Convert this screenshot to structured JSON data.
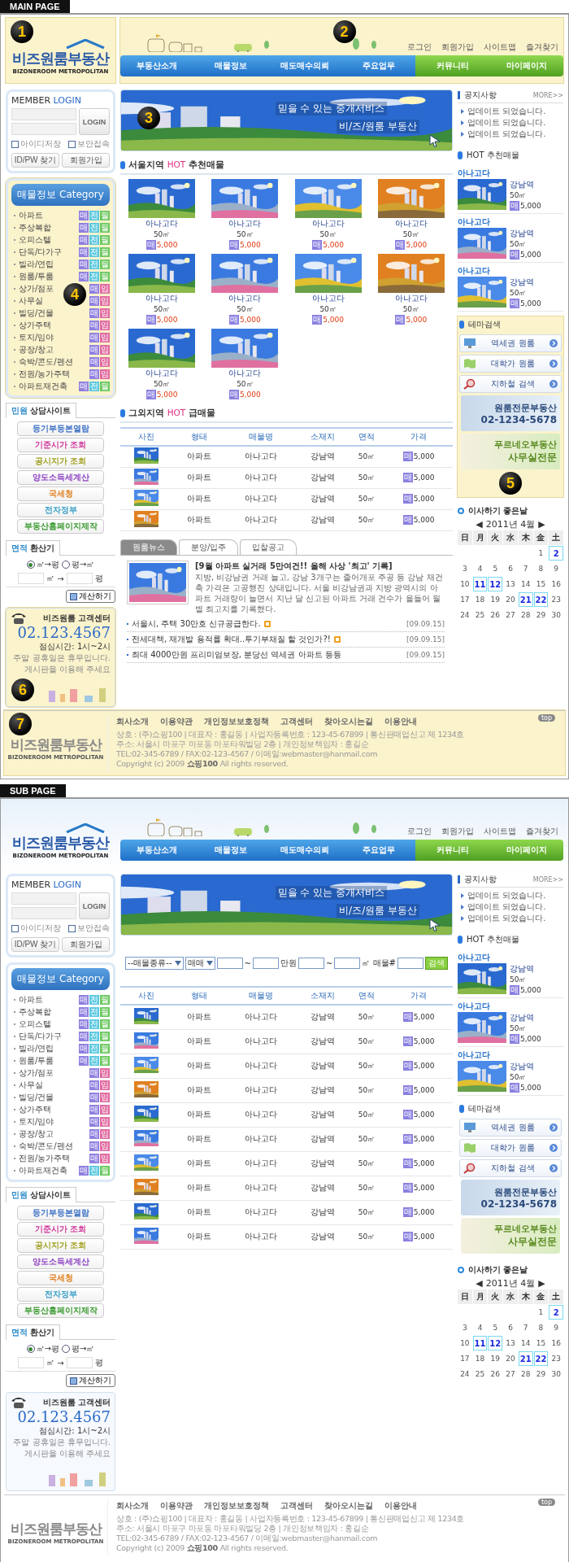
{
  "pages": [
    {
      "label": "MAIN PAGE",
      "kind": "main",
      "header": {
        "logo": {
          "title": "비즈원룸부동산",
          "subtitle": "BIZONEROOM METROPOLITAN",
          "marker": "1"
        },
        "top_links": [
          "로그인",
          "회원가입",
          "사이트맵",
          "즐겨찾기"
        ],
        "nav": [
          {
            "label": "부동산소개",
            "kind": "main"
          },
          {
            "label": "매물정보",
            "kind": "main"
          },
          {
            "label": "매도매수의뢰",
            "kind": "main"
          },
          {
            "label": "주요업무",
            "kind": "main"
          },
          {
            "label": "커뮤니티",
            "kind": "member"
          },
          {
            "label": "마이페이지",
            "kind": "member"
          }
        ],
        "marker": "2"
      },
      "login": {
        "title": "MEMBER",
        "title_accent": "LOGIN",
        "button": "LOGIN",
        "options": [
          {
            "label": "아이디저장",
            "checked": false
          },
          {
            "label": "보안접속",
            "checked": false
          }
        ],
        "buttons": [
          "ID/PW 찾기",
          "회원가입"
        ]
      },
      "category": {
        "title": "매물정보",
        "title_en": "Category",
        "marker": "4",
        "items": [
          {
            "label": "아파트",
            "badges": [
              {
                "t": "매",
                "color": "#8f7fe0"
              },
              {
                "t": "전",
                "color": "#5cc8e0"
              },
              {
                "t": "월",
                "color": "#6cc860"
              }
            ]
          },
          {
            "label": "주상복합",
            "badges": [
              {
                "t": "매",
                "color": "#8f7fe0"
              },
              {
                "t": "전",
                "color": "#5cc8e0"
              },
              {
                "t": "월",
                "color": "#6cc860"
              }
            ]
          },
          {
            "label": "오피스텔",
            "badges": [
              {
                "t": "매",
                "color": "#8f7fe0"
              },
              {
                "t": "전",
                "color": "#5cc8e0"
              },
              {
                "t": "월",
                "color": "#6cc860"
              }
            ]
          },
          {
            "label": "단독/다가구",
            "badges": [
              {
                "t": "매",
                "color": "#8f7fe0"
              },
              {
                "t": "전",
                "color": "#5cc8e0"
              },
              {
                "t": "월",
                "color": "#6cc860"
              }
            ]
          },
          {
            "label": "빌라/연립",
            "badges": [
              {
                "t": "매",
                "color": "#8f7fe0"
              },
              {
                "t": "전",
                "color": "#5cc8e0"
              },
              {
                "t": "월",
                "color": "#6cc860"
              }
            ]
          },
          {
            "label": "원룸/투룸",
            "badges": [
              {
                "t": "매",
                "color": "#8f7fe0"
              },
              {
                "t": "전",
                "color": "#5cc8e0"
              },
              {
                "t": "월",
                "color": "#6cc860"
              }
            ]
          },
          {
            "label": "상가/점포",
            "badges": [
              {
                "t": "매",
                "color": "#8f7fe0"
              },
              {
                "t": "임",
                "color": "#e06aa0"
              }
            ]
          },
          {
            "label": "사무실",
            "badges": [
              {
                "t": "매",
                "color": "#8f7fe0"
              },
              {
                "t": "임",
                "color": "#e06aa0"
              }
            ]
          },
          {
            "label": "빌딩/건물",
            "badges": [
              {
                "t": "매",
                "color": "#8f7fe0"
              },
              {
                "t": "임",
                "color": "#e06aa0"
              }
            ]
          },
          {
            "label": "상가주택",
            "badges": [
              {
                "t": "매",
                "color": "#8f7fe0"
              },
              {
                "t": "임",
                "color": "#e06aa0"
              }
            ]
          },
          {
            "label": "토지/임야",
            "badges": [
              {
                "t": "매",
                "color": "#8f7fe0"
              },
              {
                "t": "임",
                "color": "#e06aa0"
              }
            ]
          },
          {
            "label": "공장/창고",
            "badges": [
              {
                "t": "매",
                "color": "#8f7fe0"
              },
              {
                "t": "임",
                "color": "#e06aa0"
              }
            ]
          },
          {
            "label": "숙박/콘도/펜션",
            "badges": [
              {
                "t": "매",
                "color": "#8f7fe0"
              },
              {
                "t": "임",
                "color": "#e06aa0"
              }
            ]
          },
          {
            "label": "전원/농가주택",
            "badges": [
              {
                "t": "매",
                "color": "#8f7fe0"
              },
              {
                "t": "임",
                "color": "#e06aa0"
              }
            ]
          },
          {
            "label": "아파트재건축",
            "badges": [
              {
                "t": "매",
                "color": "#8f7fe0"
              },
              {
                "t": "전",
                "color": "#5cc8e0"
              },
              {
                "t": "월",
                "color": "#6cc860"
              }
            ]
          }
        ]
      },
      "consult": {
        "tab_accent": "민원",
        "tab": "상담사이트",
        "links": [
          {
            "label": "등기부등본열람",
            "color": "#3a6fc4"
          },
          {
            "label": "기준시가 조회",
            "color": "#d0359a"
          },
          {
            "label": "공시지가 조회",
            "color": "#a0a020"
          },
          {
            "label": "양도소득세계산",
            "color": "#8a3ec0"
          },
          {
            "label": "국세청",
            "color": "#e08020"
          },
          {
            "label": "전자정부",
            "color": "#3aa0c8"
          },
          {
            "label": "부동산홈페이지제작",
            "color": "#3a9a30"
          }
        ]
      },
      "converter": {
        "tab_accent": "면적",
        "tab": "환산기",
        "options": [
          {
            "label": "㎡→평",
            "selected": true
          },
          {
            "label": "평→㎡",
            "selected": false
          }
        ],
        "unit_from": "㎡",
        "arrow": "→",
        "unit_to": "평",
        "button": "계산하기"
      },
      "support": {
        "title": "비즈원룸 고객센터",
        "phone": "02.123.4567",
        "hours": "점심시간: 1시~2시",
        "notes": [
          "주말 공휴일은 휴무입니다.",
          "게시판을 이용해 주세요"
        ],
        "marker": "6"
      },
      "banner": {
        "lines": [
          "믿을 수 있는 중개서비스",
          "비/즈/원룸 부동산"
        ],
        "marker": "3"
      },
      "blocks": [
        {
          "kind": "gallery",
          "title": {
            "pre": "서울지역",
            "accent": "HOT",
            "post": "추천매물"
          },
          "items": [
            {
              "name": "아나고다",
              "area": "50㎡",
              "tag": "매",
              "price": "5,000"
            },
            {
              "name": "아나고다",
              "area": "50㎡",
              "tag": "매",
              "price": "5,000"
            },
            {
              "name": "아나고다",
              "area": "50㎡",
              "tag": "매",
              "price": "5,000"
            },
            {
              "name": "아나고다",
              "area": "50㎡",
              "tag": "매",
              "price": "5,000"
            },
            {
              "name": "아나고다",
              "area": "50㎡",
              "tag": "매",
              "price": "5,000"
            },
            {
              "name": "아나고다",
              "area": "50㎡",
              "tag": "매",
              "price": "5,000"
            },
            {
              "name": "아나고다",
              "area": "50㎡",
              "tag": "매",
              "price": "5,000"
            },
            {
              "name": "아나고다",
              "area": "50㎡",
              "tag": "매",
              "price": "5,000"
            },
            {
              "name": "아나고다",
              "area": "50㎡",
              "tag": "매",
              "price": "5,000"
            },
            {
              "name": "아나고다",
              "area": "50㎡",
              "tag": "매",
              "price": "5,000"
            }
          ]
        },
        {
          "kind": "table",
          "title": {
            "pre": "그외지역",
            "accent": "HOT",
            "post": "급매물"
          },
          "columns": [
            "사진",
            "형태",
            "매물명",
            "소재지",
            "면적",
            "가격"
          ],
          "rows": [
            {
              "type": "아파트",
              "name": "아나고다",
              "location": "강남역",
              "area": "50㎡",
              "tag": "매",
              "price": "5,000"
            },
            {
              "type": "아파트",
              "name": "아나고다",
              "location": "강남역",
              "area": "50㎡",
              "tag": "매",
              "price": "5,000"
            },
            {
              "type": "아파트",
              "name": "아나고다",
              "location": "강남역",
              "area": "50㎡",
              "tag": "매",
              "price": "5,000"
            },
            {
              "type": "아파트",
              "name": "아나고다",
              "location": "강남역",
              "area": "50㎡",
              "tag": "매",
              "price": "5,000"
            }
          ]
        },
        {
          "kind": "news",
          "tabs": [
            {
              "label": "원룸뉴스",
              "selected": true
            },
            {
              "label": "분양/입주",
              "selected": false
            },
            {
              "label": "입찰공고",
              "selected": false
            }
          ],
          "headline": "[9월 아파트 실거래 5만여건!! 올해 사상 '최고' 기록]",
          "body": "지방, 비강남권 거래 늘고, 강남 3개구는 줄어개포 주공 등 강남 재건축 가격은 고공행진 상태입니다. 서울 비강남권과 지방 광역시의 아파트 거래량이 늘면서 지난 달 신고된 아파트 거래 건수가 올들어 월별 최고치를 기록했다.",
          "items": [
            {
              "title": "서울시, 주택 30만호 신규공급한다.",
              "new": true,
              "date": "[09.09.15]"
            },
            {
              "title": "전세대책, 재개발 용적률 확대..투기부채질 할 것인가?!",
              "new": true,
              "date": "[09.09.15]"
            },
            {
              "title": "최대 4000만원 프리미엄보장, 분당선 역세권 아파트 등등",
              "new": false,
              "date": "[09.09.15]"
            }
          ]
        }
      ],
      "notice": {
        "title": "공지사항",
        "more": "MORE>>",
        "items": [
          "업데이트 되었습니다.",
          "업데이트 되었습니다.",
          "업데이트 되었습니다."
        ]
      },
      "hot": {
        "title": "HOT 추천매물",
        "items": [
          {
            "name": "아나고다",
            "location": "강남역",
            "area": "50㎡",
            "tag": "매",
            "price": "5,000"
          },
          {
            "name": "아나고다",
            "location": "강남역",
            "area": "50㎡",
            "tag": "매",
            "price": "5,000"
          },
          {
            "name": "아나고다",
            "location": "강남역",
            "area": "50㎡",
            "tag": "매",
            "price": "5,000"
          }
        ]
      },
      "theme": {
        "title": "테마검색",
        "buttons": [
          "역세권 원룸",
          "대학가 원룸",
          "지하철 검색"
        ],
        "ads": [
          {
            "line1": "원룸전문부동산",
            "line2": "02-1234-5678"
          },
          {
            "line1": "푸르네오부동산",
            "line2": "사무실전문"
          }
        ],
        "marker": "5"
      },
      "calendar": {
        "title": "이사하기 좋은날",
        "prev": "◀",
        "month": "2011년 4월",
        "next": "▶",
        "weekdays": [
          "日",
          "月",
          "火",
          "水",
          "木",
          "金",
          "土"
        ],
        "weeks": [
          [
            {
              "d": "1",
              "good": false
            },
            {
              "d": "2",
              "good": true
            }
          ],
          [
            {
              "d": "3",
              "good": false
            },
            {
              "d": "4",
              "good": false
            },
            {
              "d": "5",
              "good": false
            },
            {
              "d": "6",
              "good": false
            },
            {
              "d": "7",
              "good": false
            },
            {
              "d": "8",
              "good": false
            },
            {
              "d": "9",
              "good": false
            }
          ],
          [
            {
              "d": "10",
              "good": false
            },
            {
              "d": "11",
              "good": true
            },
            {
              "d": "12",
              "good": true
            },
            {
              "d": "13",
              "good": false
            },
            {
              "d": "14",
              "good": false
            },
            {
              "d": "15",
              "good": false
            },
            {
              "d": "16",
              "good": false
            }
          ],
          [
            {
              "d": "17",
              "good": false
            },
            {
              "d": "18",
              "good": false
            },
            {
              "d": "19",
              "good": false
            },
            {
              "d": "20",
              "good": false
            },
            {
              "d": "21",
              "good": true
            },
            {
              "d": "22",
              "good": true
            },
            {
              "d": "23",
              "good": false
            }
          ],
          [
            {
              "d": "24",
              "good": false
            },
            {
              "d": "25",
              "good": false
            },
            {
              "d": "26",
              "good": false
            },
            {
              "d": "27",
              "good": false
            },
            {
              "d": "28",
              "good": false
            },
            {
              "d": "29",
              "good": false
            },
            {
              "d": "30",
              "good": false
            }
          ]
        ]
      },
      "footer": {
        "logo": "비즈원룸부동산",
        "logo_sub": "BIZONEROOM METROPOLITAN",
        "links": [
          "회사소개",
          "이용약관",
          "개인정보보호정책",
          "고객센터",
          "찾아오시는길",
          "이용안내"
        ],
        "lines": [
          "상호 : (주)쇼핑100 | 대표자 : 홍길동 | 사업자등록번호 : 123-45-67899 | 통신판매업신고 제 1234호",
          "주소: 서울시 마포구 마포동 마포타워빌딩 2층 | 개인정보책임자 : 홍길순",
          "TEL:02-345-6789 / FAX:02-123-4567 / 이메일:webmaster@hanmail.com",
          "Copyright (c) 2009 **쇼핑100** All rights reserved."
        ],
        "top": "top",
        "marker": "7"
      }
    },
    {
      "label": "SUB PAGE",
      "kind": "sub",
      "header": {
        "logo": {
          "title": "비즈원룸부동산",
          "subtitle": "BIZONEROOM METROPOLITAN"
        },
        "top_links": [
          "로그인",
          "회원가입",
          "사이트맵",
          "즐겨찾기"
        ],
        "nav": [
          {
            "label": "부동산소개",
            "kind": "main"
          },
          {
            "label": "매물정보",
            "kind": "main"
          },
          {
            "label": "매도매수의뢰",
            "kind": "main"
          },
          {
            "label": "주요업무",
            "kind": "main"
          },
          {
            "label": "커뮤니티",
            "kind": "member"
          },
          {
            "label": "마이페이지",
            "kind": "member"
          }
        ]
      },
      "login": {
        "title": "MEMBER",
        "title_accent": "LOGIN",
        "button": "LOGIN",
        "options": [
          {
            "label": "아이디저장",
            "checked": false
          },
          {
            "label": "보안접속",
            "checked": false
          }
        ],
        "buttons": [
          "ID/PW 찾기",
          "회원가입"
        ]
      },
      "category": {
        "title": "매물정보",
        "title_en": "Category",
        "items": [
          {
            "label": "아파트",
            "badges": [
              {
                "t": "매",
                "color": "#8f7fe0"
              },
              {
                "t": "전",
                "color": "#5cc8e0"
              },
              {
                "t": "월",
                "color": "#6cc860"
              }
            ]
          },
          {
            "label": "주상복합",
            "badges": [
              {
                "t": "매",
                "color": "#8f7fe0"
              },
              {
                "t": "전",
                "color": "#5cc8e0"
              },
              {
                "t": "월",
                "color": "#6cc860"
              }
            ]
          },
          {
            "label": "오피스텔",
            "badges": [
              {
                "t": "매",
                "color": "#8f7fe0"
              },
              {
                "t": "전",
                "color": "#5cc8e0"
              },
              {
                "t": "월",
                "color": "#6cc860"
              }
            ]
          },
          {
            "label": "단독/다가구",
            "badges": [
              {
                "t": "매",
                "color": "#8f7fe0"
              },
              {
                "t": "전",
                "color": "#5cc8e0"
              },
              {
                "t": "월",
                "color": "#6cc860"
              }
            ]
          },
          {
            "label": "빌라/연립",
            "badges": [
              {
                "t": "매",
                "color": "#8f7fe0"
              },
              {
                "t": "전",
                "color": "#5cc8e0"
              },
              {
                "t": "월",
                "color": "#6cc860"
              }
            ]
          },
          {
            "label": "원룸/투룸",
            "badges": [
              {
                "t": "매",
                "color": "#8f7fe0"
              },
              {
                "t": "전",
                "color": "#5cc8e0"
              },
              {
                "t": "월",
                "color": "#6cc860"
              }
            ]
          },
          {
            "label": "상가/점포",
            "badges": [
              {
                "t": "매",
                "color": "#8f7fe0"
              },
              {
                "t": "임",
                "color": "#e06aa0"
              }
            ]
          },
          {
            "label": "사무실",
            "badges": [
              {
                "t": "매",
                "color": "#8f7fe0"
              },
              {
                "t": "임",
                "color": "#e06aa0"
              }
            ]
          },
          {
            "label": "빌딩/건물",
            "badges": [
              {
                "t": "매",
                "color": "#8f7fe0"
              },
              {
                "t": "임",
                "color": "#e06aa0"
              }
            ]
          },
          {
            "label": "상가주택",
            "badges": [
              {
                "t": "매",
                "color": "#8f7fe0"
              },
              {
                "t": "임",
                "color": "#e06aa0"
              }
            ]
          },
          {
            "label": "토지/임야",
            "badges": [
              {
                "t": "매",
                "color": "#8f7fe0"
              },
              {
                "t": "임",
                "color": "#e06aa0"
              }
            ]
          },
          {
            "label": "공장/창고",
            "badges": [
              {
                "t": "매",
                "color": "#8f7fe0"
              },
              {
                "t": "임",
                "color": "#e06aa0"
              }
            ]
          },
          {
            "label": "숙박/콘도/펜션",
            "badges": [
              {
                "t": "매",
                "color": "#8f7fe0"
              },
              {
                "t": "임",
                "color": "#e06aa0"
              }
            ]
          },
          {
            "label": "전원/농가주택",
            "badges": [
              {
                "t": "매",
                "color": "#8f7fe0"
              },
              {
                "t": "임",
                "color": "#e06aa0"
              }
            ]
          },
          {
            "label": "아파트재건축",
            "badges": [
              {
                "t": "매",
                "color": "#8f7fe0"
              },
              {
                "t": "전",
                "color": "#5cc8e0"
              },
              {
                "t": "월",
                "color": "#6cc860"
              }
            ]
          }
        ]
      },
      "consult": {
        "tab_accent": "민원",
        "tab": "상담사이트",
        "links": [
          {
            "label": "등기부등본열람",
            "color": "#3a6fc4"
          },
          {
            "label": "기준시가 조회",
            "color": "#d0359a"
          },
          {
            "label": "공시지가 조회",
            "color": "#a0a020"
          },
          {
            "label": "양도소득세계산",
            "color": "#8a3ec0"
          },
          {
            "label": "국세청",
            "color": "#e08020"
          },
          {
            "label": "전자정부",
            "color": "#3aa0c8"
          },
          {
            "label": "부동산홈페이지제작",
            "color": "#3a9a30"
          }
        ]
      },
      "converter": {
        "tab_accent": "면적",
        "tab": "환산기",
        "options": [
          {
            "label": "㎡→평",
            "selected": true
          },
          {
            "label": "평→㎡",
            "selected": false
          }
        ],
        "unit_from": "㎡",
        "arrow": "→",
        "unit_to": "평",
        "button": "계산하기"
      },
      "support": {
        "title": "비즈원룸 고객센터",
        "phone": "02.123.4567",
        "hours": "점심시간: 1시~2시",
        "notes": [
          "주말 공휴일은 휴무입니다.",
          "게시판을 이용해 주세요"
        ]
      },
      "banner": {
        "lines": [
          "믿을 수 있는 중개서비스",
          "비/즈/원룸 부동산"
        ]
      },
      "blocks": [
        {
          "kind": "search",
          "type_select": "--매물종류--",
          "deal_select": "매매",
          "sep": "~",
          "price_unit": "만원",
          "area_sep": "~",
          "area_unit": "㎡ 매물#",
          "button": "검색"
        },
        {
          "kind": "table",
          "columns": [
            "사진",
            "형태",
            "매물명",
            "소재지",
            "면적",
            "가격"
          ],
          "rows": [
            {
              "type": "아파트",
              "name": "아나고다",
              "location": "강남역",
              "area": "50㎡",
              "tag": "매",
              "price": "5,000"
            },
            {
              "type": "아파트",
              "name": "아나고다",
              "location": "강남역",
              "area": "50㎡",
              "tag": "매",
              "price": "5,000"
            },
            {
              "type": "아파트",
              "name": "아나고다",
              "location": "강남역",
              "area": "50㎡",
              "tag": "매",
              "price": "5,000"
            },
            {
              "type": "아파트",
              "name": "아나고다",
              "location": "강남역",
              "area": "50㎡",
              "tag": "매",
              "price": "5,000"
            },
            {
              "type": "아파트",
              "name": "아나고다",
              "location": "강남역",
              "area": "50㎡",
              "tag": "매",
              "price": "5,000"
            },
            {
              "type": "아파트",
              "name": "아나고다",
              "location": "강남역",
              "area": "50㎡",
              "tag": "매",
              "price": "5,000"
            },
            {
              "type": "아파트",
              "name": "아나고다",
              "location": "강남역",
              "area": "50㎡",
              "tag": "매",
              "price": "5,000"
            },
            {
              "type": "아파트",
              "name": "아나고다",
              "location": "강남역",
              "area": "50㎡",
              "tag": "매",
              "price": "5,000"
            },
            {
              "type": "아파트",
              "name": "아나고다",
              "location": "강남역",
              "area": "50㎡",
              "tag": "매",
              "price": "5,000"
            },
            {
              "type": "아파트",
              "name": "아나고다",
              "location": "강남역",
              "area": "50㎡",
              "tag": "매",
              "price": "5,000"
            }
          ]
        }
      ],
      "notice": {
        "title": "공지사항",
        "more": "MORE>>",
        "items": [
          "업데이트 되었습니다.",
          "업데이트 되었습니다.",
          "업데이트 되었습니다."
        ]
      },
      "hot": {
        "title": "HOT 추천매물",
        "items": [
          {
            "name": "아나고다",
            "location": "강남역",
            "area": "50㎡",
            "tag": "매",
            "price": "5,000"
          },
          {
            "name": "아나고다",
            "location": "강남역",
            "area": "50㎡",
            "tag": "매",
            "price": "5,000"
          },
          {
            "name": "아나고다",
            "location": "강남역",
            "area": "50㎡",
            "tag": "매",
            "price": "5,000"
          }
        ]
      },
      "theme": {
        "title": "테마검색",
        "buttons": [
          "역세권 원룸",
          "대학가 원룸",
          "지하철 검색"
        ],
        "ads": [
          {
            "line1": "원룸전문부동산",
            "line2": "02-1234-5678"
          },
          {
            "line1": "푸르네오부동산",
            "line2": "사무실전문"
          }
        ]
      },
      "calendar": {
        "title": "이사하기 좋은날",
        "prev": "◀",
        "month": "2011년 4월",
        "next": "▶",
        "weekdays": [
          "日",
          "月",
          "火",
          "水",
          "木",
          "金",
          "土"
        ],
        "weeks": [
          [
            {
              "d": "1",
              "good": false
            },
            {
              "d": "2",
              "good": true
            }
          ],
          [
            {
              "d": "3",
              "good": false
            },
            {
              "d": "4",
              "good": false
            },
            {
              "d": "5",
              "good": false
            },
            {
              "d": "6",
              "good": false
            },
            {
              "d": "7",
              "good": false
            },
            {
              "d": "8",
              "good": false
            },
            {
              "d": "9",
              "good": false
            }
          ],
          [
            {
              "d": "10",
              "good": false
            },
            {
              "d": "11",
              "good": true
            },
            {
              "d": "12",
              "good": true
            },
            {
              "d": "13",
              "good": false
            },
            {
              "d": "14",
              "good": false
            },
            {
              "d": "15",
              "good": false
            },
            {
              "d": "16",
              "good": false
            }
          ],
          [
            {
              "d": "17",
              "good": false
            },
            {
              "d": "18",
              "good": false
            },
            {
              "d": "19",
              "good": false
            },
            {
              "d": "20",
              "good": false
            },
            {
              "d": "21",
              "good": true
            },
            {
              "d": "22",
              "good": true
            },
            {
              "d": "23",
              "good": false
            }
          ],
          [
            {
              "d": "24",
              "good": false
            },
            {
              "d": "25",
              "good": false
            },
            {
              "d": "26",
              "good": false
            },
            {
              "d": "27",
              "good": false
            },
            {
              "d": "28",
              "good": false
            },
            {
              "d": "29",
              "good": false
            },
            {
              "d": "30",
              "good": false
            }
          ]
        ]
      },
      "footer": {
        "logo": "비즈원룸부동산",
        "logo_sub": "BIZONEROOM METROPOLITAN",
        "links": [
          "회사소개",
          "이용약관",
          "개인정보보호정책",
          "고객센터",
          "찾아오시는길",
          "이용안내"
        ],
        "lines": [
          "상호 : (주)쇼핑100 | 대표자 : 홍길동 | 사업자등록번호 : 123-45-67899 | 통신판매업신고 제 1234호",
          "주소: 서울시 마포구 마포동 마포타워빌딩 2층 | 개인정보책임자 : 홍길순",
          "TEL:02-345-6789 / FAX:02-123-4567 / 이메일:webmaster@hanmail.com",
          "Copyright (c) 2009 **쇼핑100** All rights reserved."
        ],
        "top": "top"
      }
    }
  ]
}
